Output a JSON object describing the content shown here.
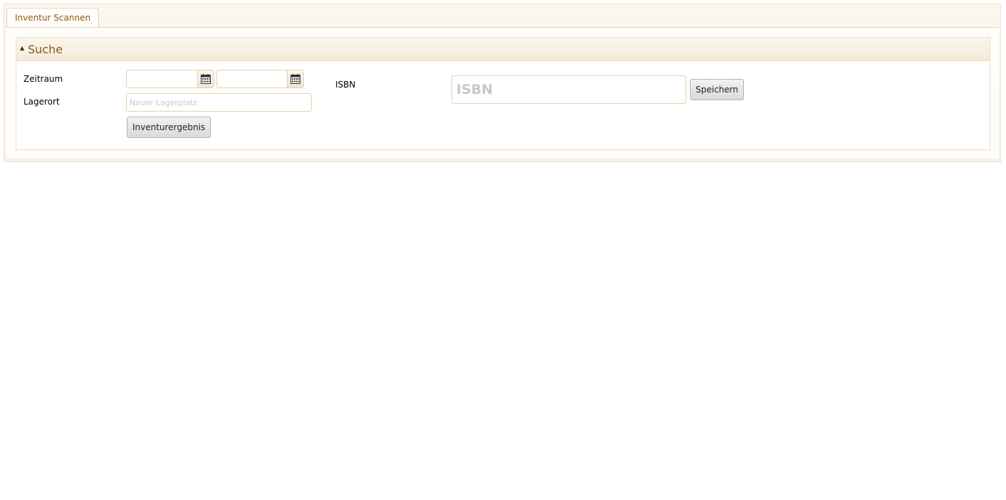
{
  "tabs": [
    {
      "label": "Inventur Scannen",
      "active": true
    }
  ],
  "search_panel": {
    "title": "Suche",
    "collapsed": false,
    "zeitraum_label": "Zeitraum",
    "date_from_value": "",
    "date_to_value": "",
    "lagerort_label": "Lagerort",
    "lagerort_value": "",
    "lagerort_placeholder": "Neuer Lagerplatz",
    "inventurergebnis_button": "Inventurergebnis",
    "isbn_label": "ISBN",
    "isbn_value": "",
    "isbn_placeholder": "ISBN",
    "save_button": "Speichern"
  },
  "icons": {
    "collapse": "triangle-up-icon",
    "date_picker": "calendar-icon"
  },
  "colors": {
    "accent_text": "#8a5a12",
    "panel_bg": "#fbf7ef",
    "border": "#e3d3aa"
  }
}
